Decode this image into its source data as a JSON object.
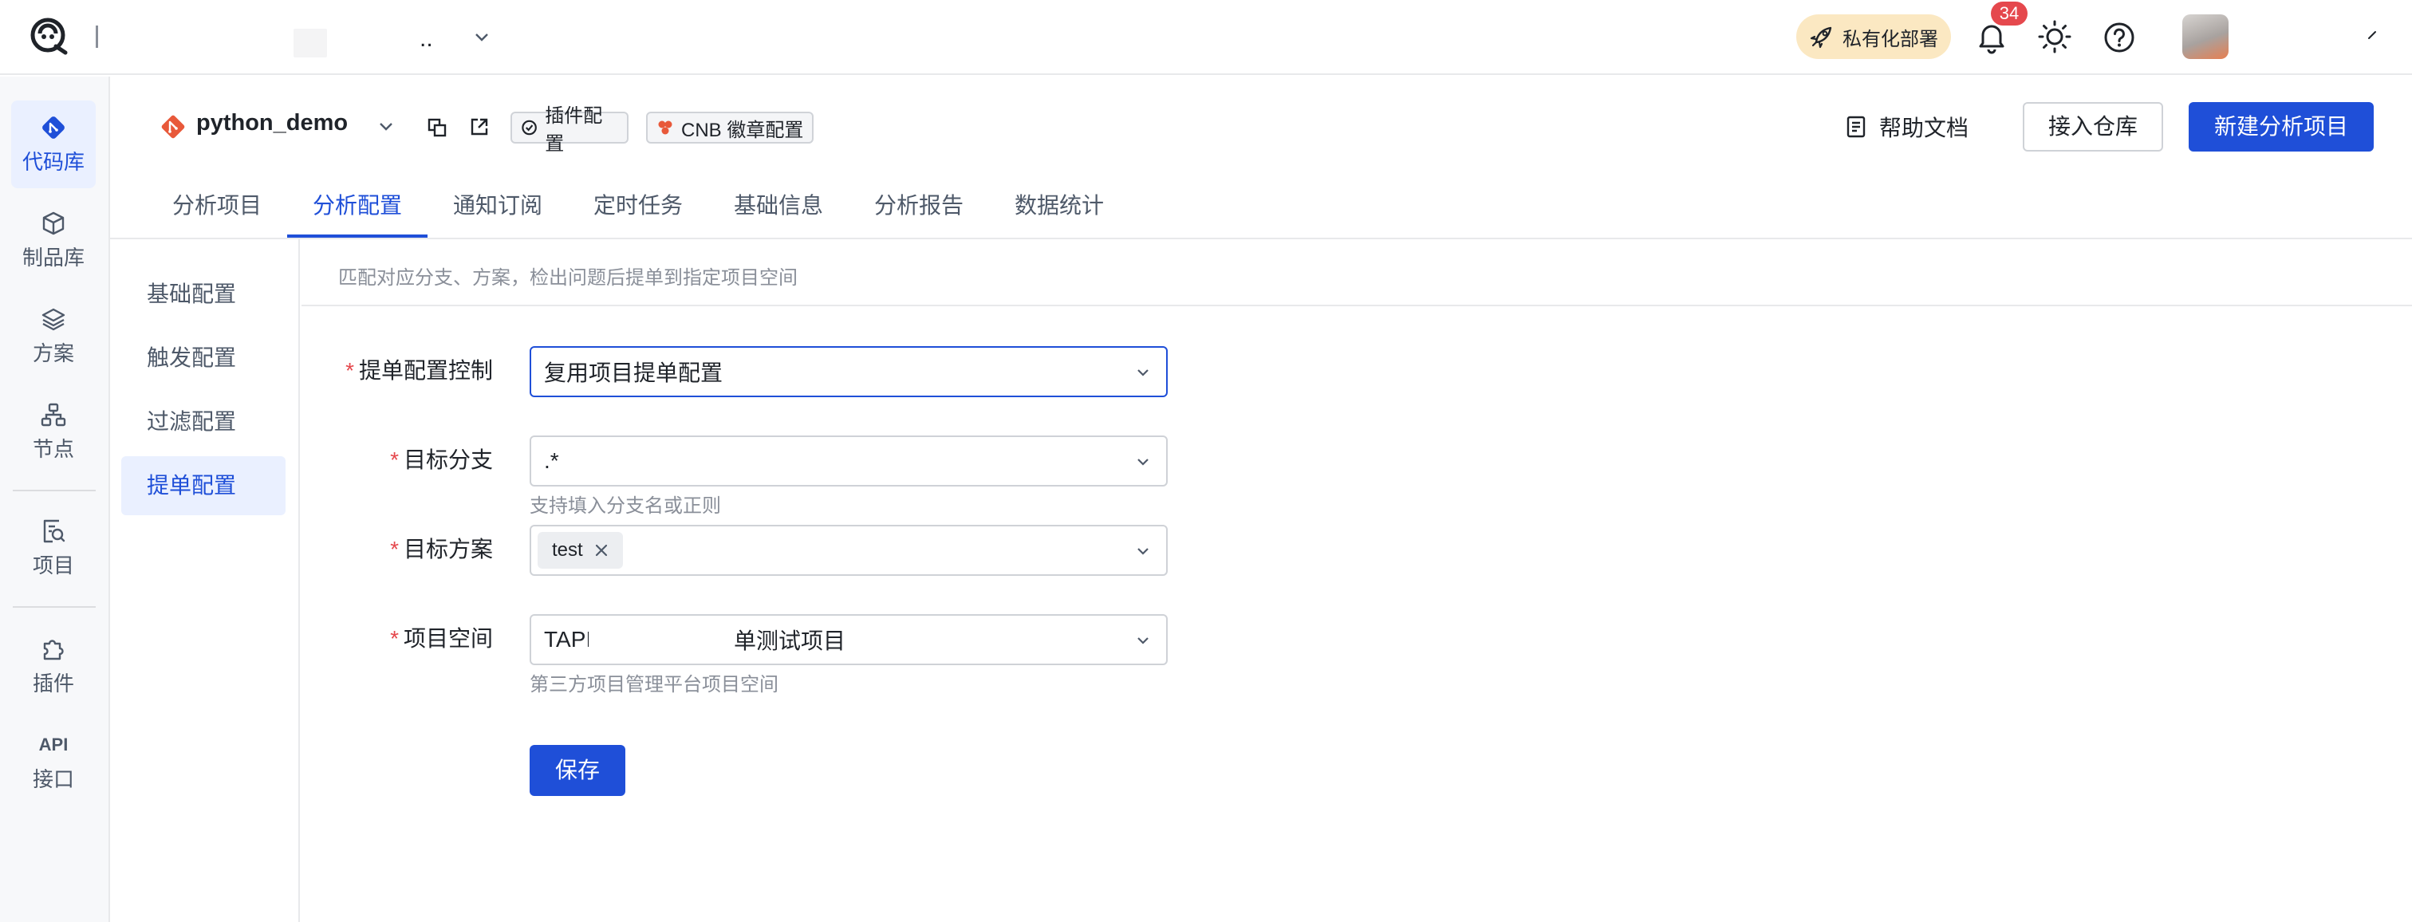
{
  "topbar": {
    "dots": "..",
    "private_deploy": "私有化部署",
    "notification_count": "34"
  },
  "leftnav": {
    "items": [
      {
        "label": "代码库",
        "icon": "repo-icon",
        "active": true
      },
      {
        "label": "制品库",
        "icon": "package-icon"
      },
      {
        "label": "方案",
        "icon": "layers-icon"
      },
      {
        "label": "节点",
        "icon": "nodes-icon"
      },
      {
        "label": "项目",
        "icon": "project-search-icon"
      },
      {
        "label": "插件",
        "icon": "puzzle-icon"
      },
      {
        "label_top": "API",
        "label": "接口"
      }
    ]
  },
  "header": {
    "repo_name": "python_demo",
    "tag_plugin": "插件配置",
    "tag_cnb": "CNB 徽章配置",
    "help_doc": "帮助文档",
    "connect_repo": "接入仓库",
    "new_project": "新建分析项目"
  },
  "tabs": [
    {
      "label": "分析项目"
    },
    {
      "label": "分析配置",
      "active": true
    },
    {
      "label": "通知订阅"
    },
    {
      "label": "定时任务"
    },
    {
      "label": "基础信息"
    },
    {
      "label": "分析报告"
    },
    {
      "label": "数据统计"
    }
  ],
  "subnav": [
    {
      "label": "基础配置"
    },
    {
      "label": "触发配置"
    },
    {
      "label": "过滤配置"
    },
    {
      "label": "提单配置",
      "active": true
    }
  ],
  "content": {
    "description": "匹配对应分支、方案，检出问题后提单到指定项目空间",
    "form": {
      "control": {
        "label": "提单配置控制",
        "value": "复用项目提单配置"
      },
      "branch": {
        "label": "目标分支",
        "value": ".*",
        "hint": "支持填入分支名或正则"
      },
      "scheme": {
        "label": "目标方案",
        "chip": "test"
      },
      "space": {
        "label": "项目空间",
        "value_prefix": "TAPI",
        "value_suffix": "单测试项目",
        "hint": "第三方项目管理平台项目空间"
      }
    },
    "save": "保存"
  },
  "colors": {
    "primary": "#1f4fd8",
    "danger": "#e5484d",
    "private_bg": "#fbe8c2",
    "nav_active_bg": "#eaf0ff"
  }
}
